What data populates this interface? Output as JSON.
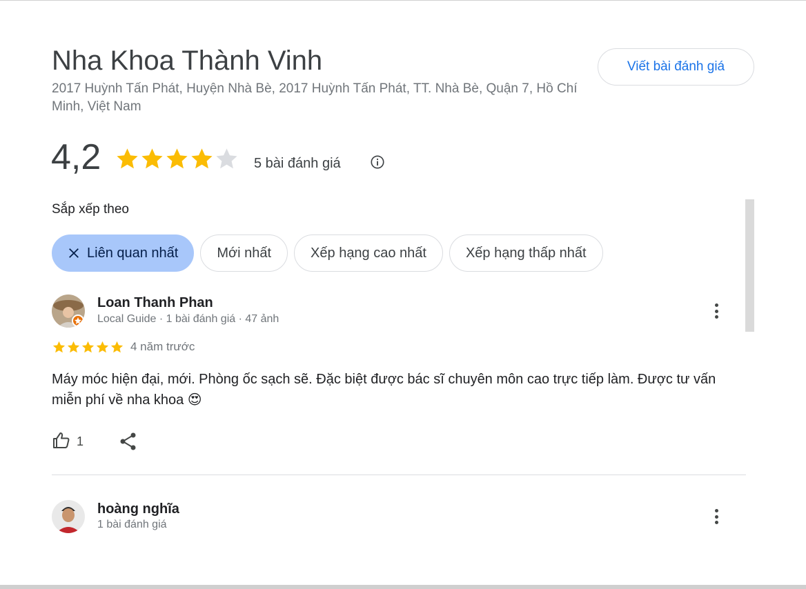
{
  "place": {
    "name": "Nha Khoa Thành Vinh",
    "address": "2017 Huỳnh Tấn Phát, Huyện Nhà Bè, 2017 Huỳnh Tấn Phát, TT. Nhà Bè, Quận 7, Hồ Chí Minh, Việt Nam"
  },
  "actions": {
    "write_review": "Viết bài đánh giá"
  },
  "rating": {
    "value": "4,2",
    "stars": 4.2,
    "max": 5,
    "count_text": "5 bài đánh giá"
  },
  "sort": {
    "label": "Sắp xếp theo",
    "options": [
      {
        "label": "Liên quan nhất",
        "active": true
      },
      {
        "label": "Mới nhất",
        "active": false
      },
      {
        "label": "Xếp hạng cao nhất",
        "active": false
      },
      {
        "label": "Xếp hạng thấp nhất",
        "active": false
      }
    ]
  },
  "reviews": [
    {
      "name": "Loan Thanh Phan",
      "meta": "Local Guide · 1 bài đánh giá · 47 ảnh",
      "stars": 5,
      "time": "4 năm trước",
      "text": "Máy móc hiện đại, mới. Phòng ốc sạch sẽ. Đặc biệt được bác sĩ chuyên môn cao trực tiếp làm. Được tư vấn miễn phí về nha khoa 😍",
      "likes": "1"
    },
    {
      "name": "hoàng nghĩa",
      "meta": "1 bài đánh giá"
    }
  ],
  "colors": {
    "star": "#fbbc04",
    "star_empty": "#dadce0",
    "accent": "#1a73e8",
    "chip_active": "#a8c7fa"
  }
}
